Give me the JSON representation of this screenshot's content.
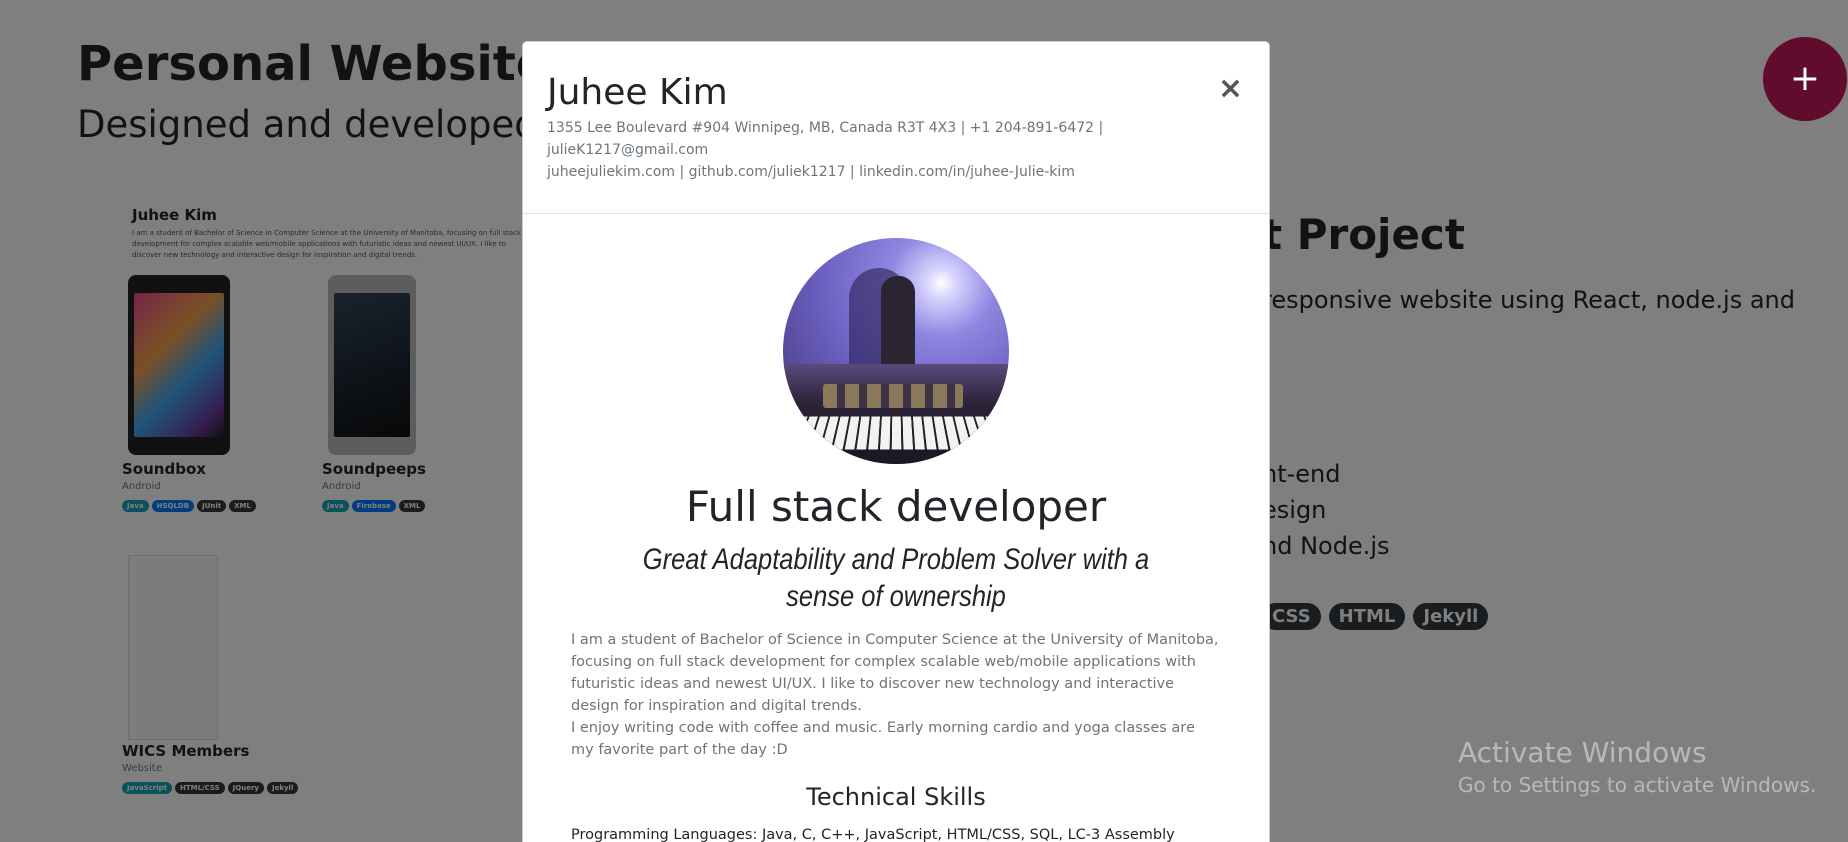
{
  "background": {
    "title": "Personal Website",
    "subtitle": "Designed and developed p",
    "preview": {
      "name": "Juhee Kim",
      "desc": "I am a student of Bachelor of Science in Computer Science at the University of Manitoba, focusing on full stack development for complex scalable web/mobile applications with futuristic ideas and newest UI/UX. I like to discover new technology and interactive design for inspiration and digital trends.",
      "cards": [
        {
          "title": "Soundbox",
          "platform": "Android",
          "tags": [
            "Java",
            "HSQLDB",
            "JUnit",
            "XML"
          ]
        },
        {
          "title": "Soundpeeps",
          "platform": "Android",
          "tags": [
            "Java",
            "Firebase",
            "XML"
          ]
        },
        {
          "title": "WICS Members",
          "platform": "Website",
          "tags": [
            "JavaScript",
            "HTML/CSS",
            "JQuery",
            "Jekyll"
          ]
        }
      ]
    },
    "project": {
      "title": "t Project",
      "desc": "responsive website using React, node.js and",
      "list": [
        "nt-end",
        "esign",
        "nd Node.js"
      ],
      "tags": [
        "CSS",
        "HTML",
        "Jekyll"
      ]
    }
  },
  "fab": {
    "label": "+"
  },
  "watermark": {
    "line1": "Activate Windows",
    "line2": "Go to Settings to activate Windows."
  },
  "modal": {
    "name": "Juhee Kim",
    "contact_line1": "1355 Lee Boulevard #904 Winnipeg, MB, Canada R3T 4X3 | +1 204-891-6472 | julieK1217@gmail.com",
    "contact_line2": "juheejuliekim.com | github.com/juliek1217 | linkedin.com/in/juhee-Julie-kim",
    "close_label": "×",
    "role": "Full stack developer",
    "tagline": "Great Adaptability and Problem Solver with a sense of ownership",
    "bio_p1": "I am a student of Bachelor of Science in Computer Science at the University of Manitoba, focusing on full stack development for complex scalable web/mobile applications with futuristic ideas and newest UI/UX. I like to discover new technology and interactive design for inspiration and digital trends.",
    "bio_p2": "I enjoy writing code with coffee and music. Early morning cardio and yoga classes are my favorite part of the day :D",
    "skills_title": "Technical Skills",
    "skills_languages": "Programming Languages: Java, C, C++, JavaScript, HTML/CSS, SQL, LC-3 Assembly"
  }
}
